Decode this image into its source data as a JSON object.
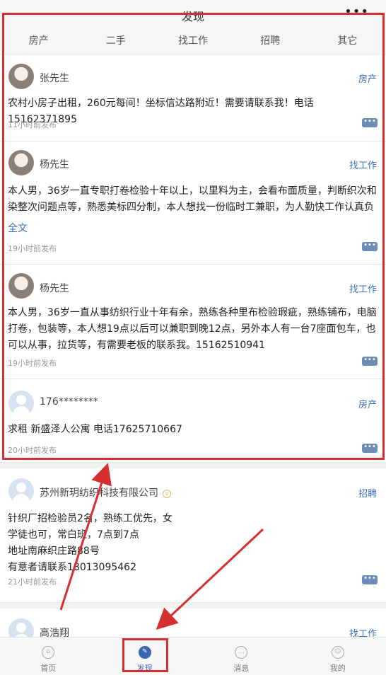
{
  "header": {
    "title": "发现",
    "more": "•••"
  },
  "tabs": [
    "房产",
    "二手",
    "找工作",
    "招聘",
    "其它"
  ],
  "posts": [
    {
      "name": "张先生",
      "category": "房产",
      "content": "农村小房子出租，260元每间！坐标信达路附近！需要请联系我！电话15162371895",
      "time": "11小时前发布"
    },
    {
      "name": "杨先生",
      "category": "找工作",
      "content": "本人男，36岁一直专职打卷检验十年以上，以里料为主，会看布面质量，判断织次和染整次问题点等，熟悉美标四分制，本人想找一份临时工兼职，为人勤快工作认真负",
      "fulltext": "全文",
      "time": "19小时前发布"
    },
    {
      "name": "杨先生",
      "category": "找工作",
      "content": "本人男，36岁一直从事纺织行业十年有余，熟练各种里布检验瑕疵，熟练铺布，电脑打卷，包装等，本人想19点以后可以兼职到晚12点，另外本人有一台7座面包车，也可以从事，拉货等，有需要老板的联系我。15162510941",
      "time": "19小时前发布"
    },
    {
      "name": "176********",
      "category": "房产",
      "content": "求租 新盛泽人公寓 电话17625710667",
      "time": "20小时前发布"
    },
    {
      "name": "苏州新玥纺织科技有限公司",
      "category": "招聘",
      "content": "针织厂招检验员2名，熟练工优先，女学徒也可，常白班，7点到7点\n地址南麻织庄路88号\n有意者请联系18013095462",
      "time": "21小时前发布"
    },
    {
      "name": "高浩翔",
      "category": "找工作"
    }
  ],
  "nav": [
    {
      "label": "首页",
      "icon": "home-icon"
    },
    {
      "label": "发现",
      "icon": "compass-icon"
    },
    {
      "label": "消息",
      "icon": "message-icon"
    },
    {
      "label": "我的",
      "icon": "user-icon"
    }
  ]
}
